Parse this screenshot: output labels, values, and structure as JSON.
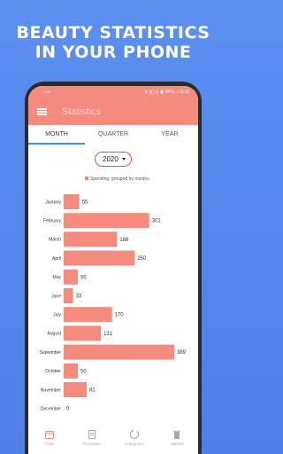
{
  "promo": {
    "line1": "BEAUTY STATISTICS",
    "line2": "IN YOUR PHONE"
  },
  "status": {
    "left": "ᵢₗ ≋",
    "right": "⊙ ◧ ⊡ ▣ 88% ▭ 6:55"
  },
  "app": {
    "title": "Statistics"
  },
  "tabs": [
    {
      "label": "MONTH",
      "active": true
    },
    {
      "label": "QUARTER",
      "active": false
    },
    {
      "label": "YEAR",
      "active": false
    }
  ],
  "year_select": {
    "value": "2020"
  },
  "chart_data": {
    "type": "bar",
    "orientation": "horizontal",
    "series": [
      {
        "name": "Spending, grouped by months"
      }
    ],
    "categories": [
      "January",
      "February",
      "March",
      "April",
      "May",
      "June",
      "July",
      "August",
      "September",
      "October",
      "November",
      "December"
    ],
    "values": [
      55,
      301,
      188,
      250,
      50,
      33,
      170,
      131,
      389,
      50,
      81,
      0
    ],
    "bar_color": "#f58a7e"
  },
  "bottom_nav": [
    {
      "label": "Calls",
      "icon": "calendar-icon",
      "active": true
    },
    {
      "label": "Purchases",
      "icon": "receipt-icon",
      "active": false
    },
    {
      "label": "Categories",
      "icon": "pie-icon",
      "active": false
    },
    {
      "label": "Utilized",
      "icon": "trash-icon",
      "active": false
    }
  ],
  "colors": {
    "accent": "#f58a7e",
    "tab_indicator": "#2aa0e8",
    "background": "#5b8ff0"
  }
}
